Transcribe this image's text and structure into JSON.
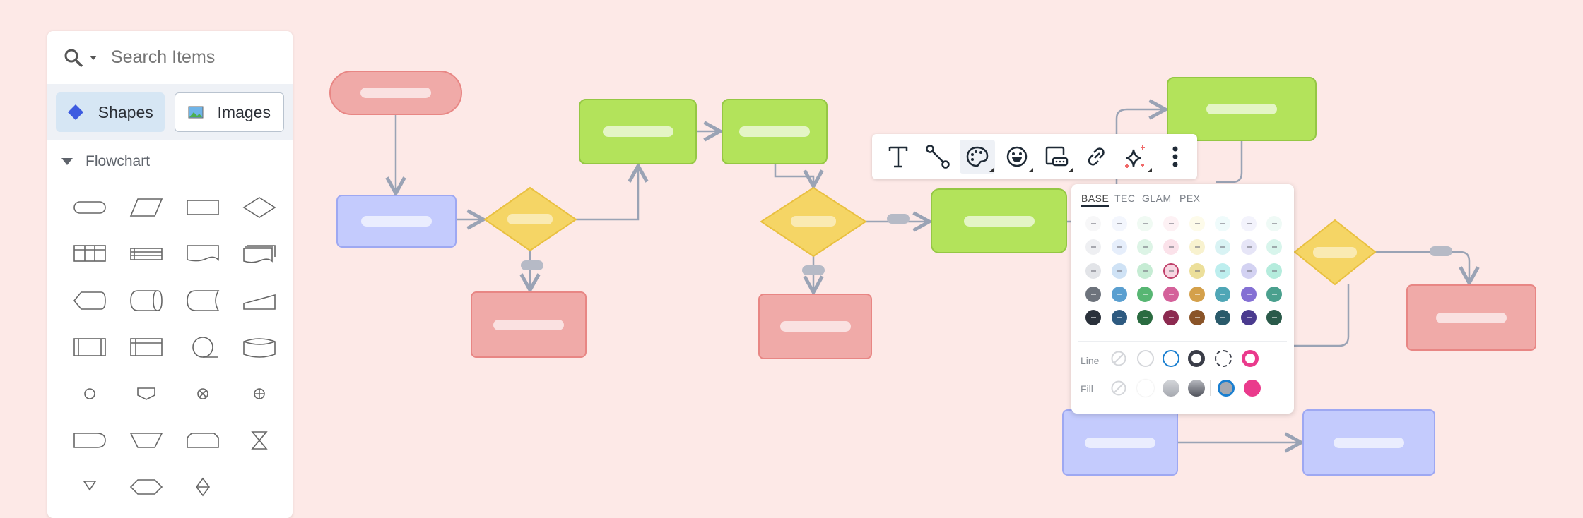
{
  "sidebar": {
    "search_placeholder": "Search Items",
    "tabs": [
      {
        "label": "Shapes",
        "icon": "diamond-icon",
        "active": true
      },
      {
        "label": "Images",
        "icon": "image-icon",
        "active": false
      }
    ],
    "section": "Flowchart",
    "shapes": [
      "terminator",
      "data",
      "process",
      "decision",
      "internal-storage",
      "list",
      "document",
      "multi-document",
      "display",
      "stored-data",
      "delay",
      "manual-input",
      "predefined-process",
      "table",
      "circle-tape",
      "database",
      "connector",
      "off-page",
      "summing-junction",
      "or",
      "delay-d",
      "manual-operation",
      "loop-limit",
      "collate",
      "merge",
      "preparation",
      "sort"
    ]
  },
  "toolbar": {
    "items": [
      {
        "name": "text-icon"
      },
      {
        "name": "connector-icon"
      },
      {
        "name": "palette-icon",
        "active": true
      },
      {
        "name": "emoji-icon"
      },
      {
        "name": "caption-icon"
      },
      {
        "name": "link-icon"
      },
      {
        "name": "sparkle-icon"
      },
      {
        "name": "more-vertical-icon"
      }
    ]
  },
  "palette": {
    "tabs": [
      "BASE",
      "TEC",
      "GLAM",
      "PEX"
    ],
    "active_tab": "BASE",
    "swatches": [
      [
        "#f7f7f8",
        "#f3f6fd",
        "#f0faf3",
        "#fdf1f4",
        "#fdfbea",
        "#effbfb",
        "#f3f3fc",
        "#effaf6"
      ],
      [
        "#eeeff2",
        "#e6eefb",
        "#ddf4e6",
        "#fbe2ea",
        "#f8f2cf",
        "#d9f3f4",
        "#e6e5f7",
        "#d8f5ec"
      ],
      [
        "#e2e4e8",
        "#cfe2f5",
        "#c6ecd4",
        "#f7d6e2",
        "#ecdf9a",
        "#bdeeee",
        "#d3d2f2",
        "#b5ecdd"
      ],
      [
        "#6d737c",
        "#5a9fd0",
        "#57b673",
        "#d4619a",
        "#d4a04a",
        "#4fa6b6",
        "#8470d4",
        "#4aa08e"
      ],
      [
        "#2a313b",
        "#2e5a80",
        "#2a6b40",
        "#8c2a50",
        "#8a5428",
        "#2a5a6a",
        "#4a3a8e",
        "#2a5a4a"
      ]
    ],
    "selected_swatch": "#f7d6e2",
    "line_label": "Line",
    "fill_label": "Fill"
  },
  "colors": {
    "background": "#fde9e7",
    "red": "#f0aaa8",
    "blue": "#c4cbfd",
    "green": "#b3e35b",
    "yellow": "#f5d565",
    "connector": "#9aa3b5"
  }
}
